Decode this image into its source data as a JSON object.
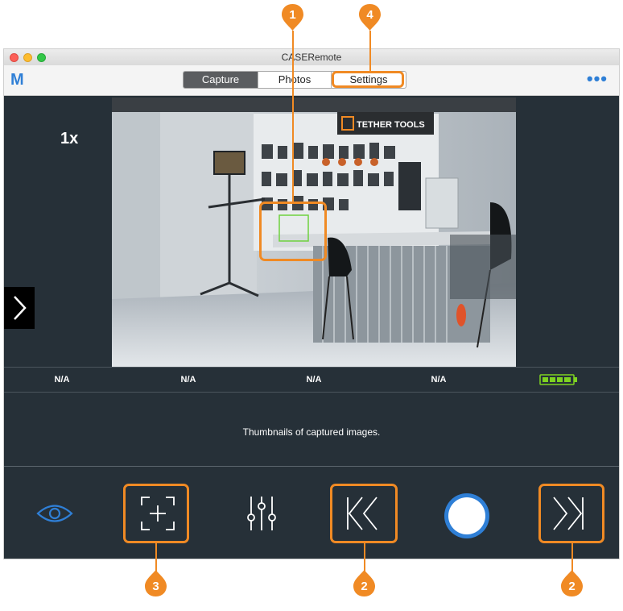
{
  "window": {
    "title": "CASERemote"
  },
  "toolbar": {
    "logo": "M",
    "tabs": [
      {
        "label": "Capture"
      },
      {
        "label": "Photos"
      },
      {
        "label": "Settings"
      }
    ],
    "more": "•••"
  },
  "camera": {
    "zoom": "1x",
    "store_sign": "TETHER TOOLS"
  },
  "stats": [
    "N/A",
    "N/A",
    "N/A",
    "N/A"
  ],
  "thumbnails": {
    "text": "Thumbnails of captured images."
  },
  "annotations": [
    "1",
    "4",
    "3",
    "2",
    "2"
  ],
  "colors": {
    "accent": "#2f7fd6",
    "callout": "#f08a24",
    "battery": "#7ed321",
    "focus": "#6fd13f",
    "window_bg": "#263038"
  }
}
